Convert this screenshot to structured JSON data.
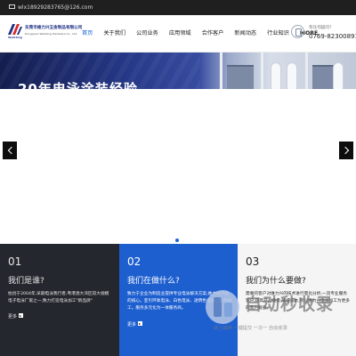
{
  "topbar": {
    "email": "wlx18929283765@126.com"
  },
  "header": {
    "logo": {
      "name_cn": "东莞市维力兴五金制品有限公司",
      "name_en": "Dongguan Weilixing Hardware Co., Ltd.",
      "mark_label": "WeiliXing"
    },
    "nav": [
      {
        "label": "首页",
        "active": true
      },
      {
        "label": "关于我们",
        "active": false
      },
      {
        "label": "公司业务",
        "active": false
      },
      {
        "label": "应用领域",
        "active": false
      },
      {
        "label": "合作客户",
        "active": false
      },
      {
        "label": "新闻动态",
        "active": false
      },
      {
        "label": "行业知识",
        "active": false
      },
      {
        "label": "MORE",
        "active": false
      }
    ],
    "contact": {
      "label": "有任何疑问?",
      "phone": "0769-82300891"
    }
  },
  "banner": {
    "title": "20年电泳涂装经验"
  },
  "carousel": {
    "dot_count": 1,
    "active_index": 0
  },
  "cards": [
    {
      "num": "01",
      "title": "我们是谁?",
      "text": "始创于2004年,早期电泳我行者,粤港澳大湾区较大规模电子电泳厂家之一,致力打造电泳加工\"新品牌\"",
      "more": "更多"
    },
    {
      "num": "02",
      "title": "我们在做什么?",
      "text": "致力于企业为制造业提供专业电泳解决方案,维力兴产品的核心。亚引环氧电泳、白色电泳、透明色电泳、黑色加工。服务多元化为一体服务商。",
      "more": "更多"
    },
    {
      "num": "03",
      "title": "我们为什么要做?",
      "text": "需要的客户对维力兴的技术进行量化分析,一流专业服务客户,提高产品质量,降低成本,所以维力兴电泳加工为更多的客户服务。",
      "more": ""
    }
  ],
  "watermark": {
    "title": "自动秒收录",
    "subtitle": "做上辅转 一键提交 一次一 自动收录"
  },
  "colors": {
    "accent": "#1a64d8",
    "topbar": "#1f1f1f",
    "card1": "#24272d",
    "card2": "#1e5fd0",
    "card3": "#f5f5f5"
  },
  "icons": {
    "topbar": "mail-icon",
    "contact": "phone-icon",
    "prev": "chevron-left-icon",
    "next": "chevron-right-icon",
    "more": "arrow-right-icon"
  }
}
